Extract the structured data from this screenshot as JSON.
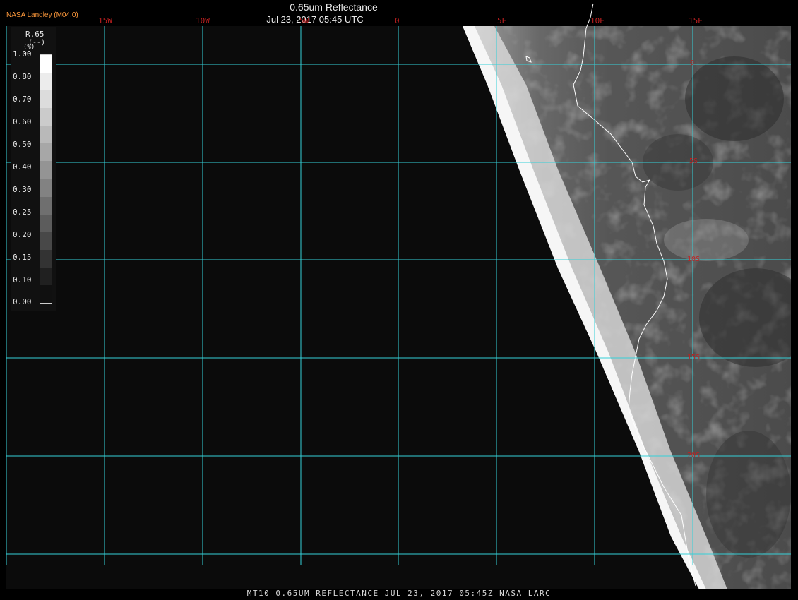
{
  "header": {
    "credit": "NASA Langley (M04.0)",
    "title": "0.65um Reflectance",
    "datetime": "Jul 23, 2017 05:45 UTC"
  },
  "footer": {
    "caption": "MT10  0.65UM REFLECTANCE   JUL 23, 2017 05:45Z   NASA LARC"
  },
  "legend": {
    "title": "R.65",
    "unit": "(--)",
    "unit_prefix": "(%)",
    "labels": [
      "1.00",
      "0.80",
      "0.70",
      "0.60",
      "0.50",
      "0.40",
      "0.30",
      "0.25",
      "0.20",
      "0.15",
      "0.10",
      "0.00"
    ],
    "shades": [
      "#ffffff",
      "#ececec",
      "#dcdcdc",
      "#cbcbcb",
      "#b9b9b9",
      "#a7a7a7",
      "#949494",
      "#828282",
      "#6f6f6f",
      "#5c5c5c",
      "#484848",
      "#333333",
      "#202020",
      "#101010"
    ]
  },
  "grid": {
    "color": "#35d0d8",
    "lon_labels": [
      "15W",
      "10W",
      "5W",
      "0",
      "5E",
      "10E",
      "15E"
    ],
    "lat_labels": [
      "0",
      "5S",
      "10S",
      "15S",
      "20S"
    ]
  },
  "colors": {
    "label": "#c02020",
    "coastline": "#ffffff",
    "ocean_space": "#0b0b0b"
  }
}
